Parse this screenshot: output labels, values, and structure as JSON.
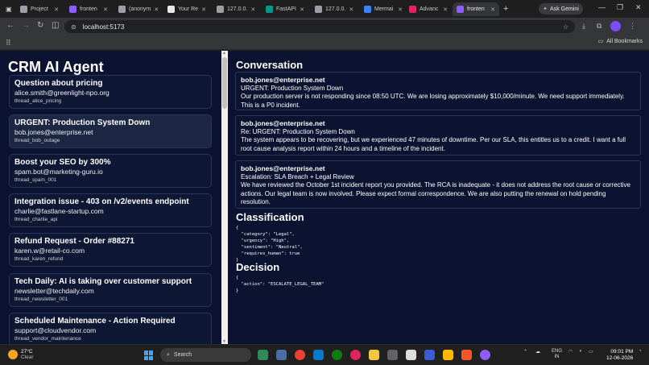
{
  "browser": {
    "tabs": [
      {
        "label": "Project",
        "color": "#9aa0a6"
      },
      {
        "label": "fronten",
        "color": "#8c5cff"
      },
      {
        "label": "(anonym",
        "color": "#9aa0a6"
      },
      {
        "label": "Your Re",
        "color": "#e8e8e8"
      },
      {
        "label": "127.0.0.",
        "color": "#9aa0a6"
      },
      {
        "label": "FastAPI",
        "color": "#05998b"
      },
      {
        "label": "127.0.0.",
        "color": "#9aa0a6"
      },
      {
        "label": "Mermai",
        "color": "#3b82f6"
      },
      {
        "label": "Advanc",
        "color": "#e0245e"
      },
      {
        "label": "fronten",
        "color": "#8c5cff"
      }
    ],
    "ask_gemini": "Ask Gemini",
    "url": "localhost:5173",
    "all_bookmarks": "All Bookmarks"
  },
  "sidebar": {
    "title": "CRM AI Agent",
    "threads": [
      {
        "subject": "Question about pricing",
        "from": "alice.smith@greenlight-npo.org",
        "id": "thread_alice_pricing"
      },
      {
        "subject": "URGENT: Production System Down",
        "from": "bob.jones@enterprise.net",
        "id": "thread_bob_outage"
      },
      {
        "subject": "Boost your SEO by 300%",
        "from": "spam.bot@marketing-guru.io",
        "id": "thread_spam_001"
      },
      {
        "subject": "Integration issue - 403 on /v2/events endpoint",
        "from": "charlie@fastlane-startup.com",
        "id": "thread_charlie_api"
      },
      {
        "subject": "Refund Request - Order #88271",
        "from": "karen.w@retail-co.com",
        "id": "thread_karen_refund"
      },
      {
        "subject": "Tech Daily: AI is taking over customer support",
        "from": "newsletter@techdaily.com",
        "id": "thread_newsletter_001"
      },
      {
        "subject": "Scheduled Maintenance - Action Required",
        "from": "support@cloudvendor.com",
        "id": "thread_vendor_maintenance"
      }
    ]
  },
  "conversation": {
    "heading": "Conversation",
    "messages": [
      {
        "sender": "bob.jones@enterprise.net",
        "subject": "URGENT: Production System Down",
        "body": "Our production server is not responding since 08:50 UTC. We are losing approximately $10,000/minute. We need support immediately. This is a P0 incident."
      },
      {
        "sender": "bob.jones@enterprise.net",
        "subject": "Re: URGENT: Production System Down",
        "body": "The system appears to be recovering, but we experienced 47 minutes of downtime. Per our SLA, this entitles us to a credit. I want a full root cause analysis report within 24 hours and a timeline of the incident."
      },
      {
        "sender": "bob.jones@enterprise.net",
        "subject": "Escalation: SLA Breach + Legal Review",
        "body": "We have reviewed the October 1st incident report you provided. The RCA is inadequate - it does not address the root cause or corrective actions. Our legal team is now involved. Please expect formal correspondence. We are also putting the renewal on hold pending resolution."
      }
    ]
  },
  "classification": {
    "heading": "Classification",
    "json": "{\n  \"category\": \"Legal\",\n  \"urgency\": \"High\",\n  \"sentiment\": \"Neutral\",\n  \"requires_human\": true\n}"
  },
  "decision": {
    "heading": "Decision",
    "json": "{\n  \"action\": \"ESCALATE_LEGAL_TEAM\"\n}"
  },
  "taskbar": {
    "temp": "27°C",
    "condition": "Clear",
    "search": "Search",
    "lang1": "ENG",
    "lang2": "IN",
    "time": "09:01 PM",
    "date": "12-06-2026"
  }
}
